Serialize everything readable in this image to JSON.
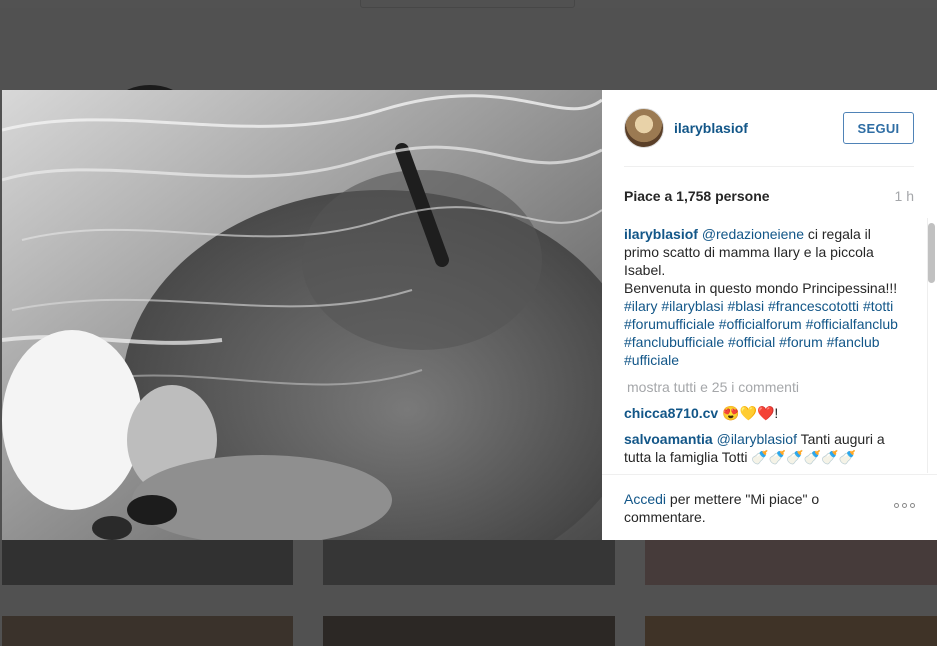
{
  "post": {
    "username": "ilaryblasiof",
    "follow_label": "SEGUI",
    "likes": "Piace a 1,758 persone",
    "time": "1 h",
    "caption": {
      "author": "ilaryblasiof",
      "mention": "@redazioneiene",
      "text1": " ci regala il primo scatto di mamma Ilary e la piccola Isabel.",
      "text2": "Benvenuta in questo mondo Principessina!!! ",
      "tags": [
        "#ilary",
        "#ilaryblasi",
        "#blasi",
        "#francescototti",
        "#totti",
        "#forumufficiale",
        "#officialforum",
        "#officialfanclub",
        "#fanclubufficiale",
        "#official",
        "#forum",
        "#fanclub",
        "#ufficiale"
      ]
    },
    "show_all_comments": "mostra tutti e 25 i commenti",
    "comments": [
      {
        "user": "chicca8710.cv",
        "text": " 😍💛❤️!"
      },
      {
        "user": "salvoamantia",
        "mention": "@ilaryblasiof",
        "text": " Tanti auguri a tutta la famiglia Totti 🍼🍼🍼🍼🍼🍼"
      }
    ],
    "footer": {
      "login_link": "Accedi",
      "login_text": " per mettere \"Mi piace\" o commentare."
    }
  },
  "colors": {
    "link": "#125688",
    "muted": "#a5a7aa",
    "follow_border": "#4f83b7"
  }
}
